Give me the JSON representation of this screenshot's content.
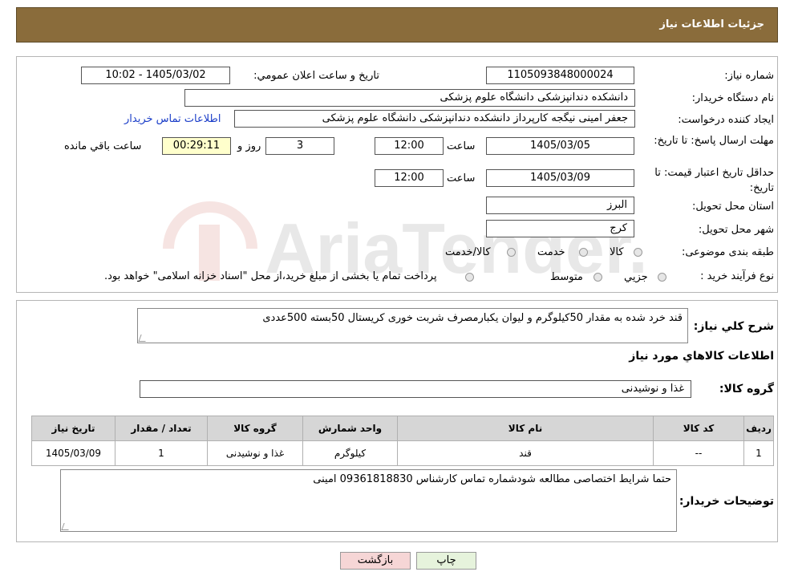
{
  "header": {
    "title": "جزئیات اطلاعات نیاز"
  },
  "fields": {
    "need_number_label": "شماره نیاز:",
    "need_number": "1105093848000024",
    "announce_label": "تاریخ و ساعت اعلان عمومي:",
    "announce_value": "1405/03/02 - 10:02",
    "buyer_org_label": "نام دستگاه خريدار:",
    "buyer_org": "دانشکده دندانپزشکی دانشگاه علوم پزشکی",
    "creator_label": "ايجاد کننده درخواست:",
    "creator": "جعفر امینی نیگجه کارپرداز دانشکده دندانپزشکی دانشگاه علوم پزشکی",
    "contact_link": "اطلاعات تماس خريدار",
    "deadline_label": "مهلت ارسال پاسخ: تا تاريخ:",
    "deadline_date": "1405/03/05",
    "time_label": "ساعت",
    "deadline_time": "12:00",
    "days": "3",
    "days_label": "روز و",
    "remaining_time": "00:29:11",
    "remaining_label": "ساعت باقي مانده",
    "validity_label": "حداقل تاريخ اعتبار قيمت: تا تاريخ:",
    "validity_date": "1405/03/09",
    "validity_time": "12:00",
    "province_label": "استان محل تحويل:",
    "province": "البرز",
    "city_label": "شهر محل تحويل:",
    "city": "کرج",
    "category_label": "طبقه بندی موضوعی:",
    "category_options": [
      "کالا",
      "خدمت",
      "کالا/خدمت"
    ],
    "process_label": "نوع فرآيند خريد :",
    "process_options": [
      "جزيي",
      "متوسط"
    ],
    "process_note": "پرداخت تمام يا بخشی از مبلغ خريد،از محل \"اسناد خزانه اسلامی\" خواهد بود."
  },
  "description": {
    "label": "شرح كلي نياز:",
    "text": "قند خرد شده به مقدار 50کیلوگرم و لیوان یکبارمصرف شربت خوری کریستال 50بسته 500عددی"
  },
  "goods": {
    "section_title": "اطلاعات كالاهاي مورد نياز",
    "group_label": "گروه کالا:",
    "group_value": "غذا و نوشیدنی"
  },
  "table": {
    "headers": [
      "رديف",
      "کد کالا",
      "نام کالا",
      "واحد شمارش",
      "گروه کالا",
      "تعداد / مقدار",
      "تاريخ نياز"
    ],
    "rows": [
      [
        "1",
        "--",
        "قند",
        "کیلوگرم",
        "غذا و نوشیدنی",
        "1",
        "1405/03/09"
      ]
    ]
  },
  "buyer_notes": {
    "label": "توضيحات خريدار:",
    "text": "حتما شرایط اختصاصی مطالعه شودشماره تماس کارشناس 09361818830 امینی"
  },
  "buttons": {
    "print": "چاپ",
    "back": "بازگشت"
  },
  "watermark": {
    "text": "AriaTender.neT"
  },
  "colors": {
    "header": "#8a6c3b",
    "link": "#1a3dc8",
    "back_button": "#f6d6d6",
    "print_button": "#e6f3dc"
  }
}
